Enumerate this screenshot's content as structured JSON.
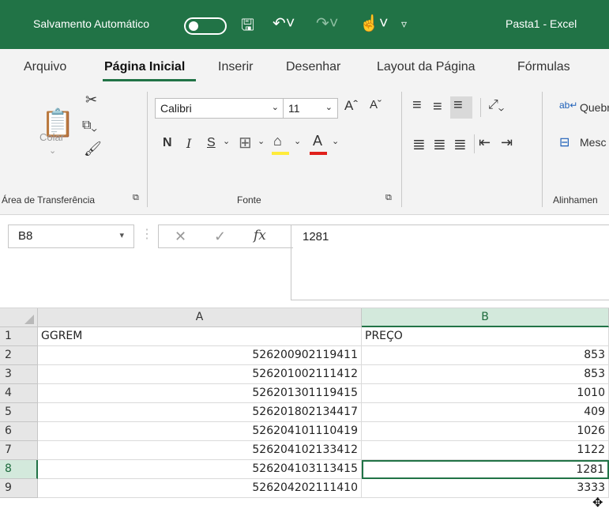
{
  "titlebar": {
    "autosave_label": "Salvamento Automático",
    "autosave_state": "off",
    "doc_title": "Pasta1  -  Excel",
    "icons": [
      "save-icon",
      "undo-icon",
      "redo-icon",
      "touch-mode-icon",
      "customize-qat-icon"
    ]
  },
  "tabs": [
    "Arquivo",
    "Página Inicial",
    "Inserir",
    "Desenhar",
    "Layout da Página",
    "Fórmulas"
  ],
  "active_tab": "Página Inicial",
  "ribbon": {
    "clipboard": {
      "paste_label": "Colar",
      "group_label": "Área de Transferência"
    },
    "font": {
      "font_name": "Calibri",
      "font_size": "11",
      "bold": "N",
      "italic": "I",
      "underline": "S",
      "font_color_letter": "A",
      "group_label": "Fonte"
    },
    "alignment": {
      "wrap_label": "Quebr",
      "merge_label": "Mesc",
      "group_label": "Alinhamen"
    },
    "colors": {
      "highlight": "#ffeb3b",
      "font_color": "#e0201b",
      "accent": "#217346"
    }
  },
  "formula_bar": {
    "name_box": "B8",
    "fx_label": "fx",
    "formula": "1281"
  },
  "sheet": {
    "columns": [
      "A",
      "B"
    ],
    "selected_column": "B",
    "selected_row": "8",
    "rows": [
      {
        "num": "1",
        "a": "GGREM",
        "b": "PREÇO"
      },
      {
        "num": "2",
        "a": "526200902119411",
        "b": "853"
      },
      {
        "num": "3",
        "a": "526201002111412",
        "b": "853"
      },
      {
        "num": "4",
        "a": "526201301119415",
        "b": "1010"
      },
      {
        "num": "5",
        "a": "526201802134417",
        "b": "409"
      },
      {
        "num": "6",
        "a": "526204101110419",
        "b": "1026"
      },
      {
        "num": "7",
        "a": "526204102133412",
        "b": "1122"
      },
      {
        "num": "8",
        "a": "526204103113415",
        "b": "1281"
      },
      {
        "num": "9",
        "a": "526204202111410",
        "b": "3333"
      }
    ]
  }
}
